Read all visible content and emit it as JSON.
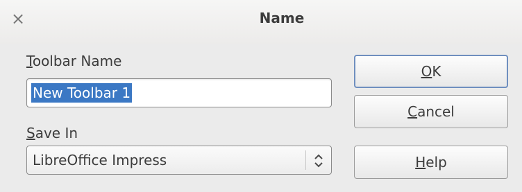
{
  "dialog": {
    "title": "Name",
    "close_icon": "close-icon"
  },
  "toolbar_name": {
    "label_mnemonic": "T",
    "label_rest": "oolbar Name",
    "value": "New Toolbar 1"
  },
  "save_in": {
    "label_mnemonic": "S",
    "label_rest": "ave In",
    "selected": "LibreOffice Impress"
  },
  "buttons": {
    "ok_mnemonic": "O",
    "ok_rest": "K",
    "cancel_mnemonic": "C",
    "cancel_rest": "ancel",
    "help_mnemonic": "H",
    "help_rest": "elp"
  }
}
